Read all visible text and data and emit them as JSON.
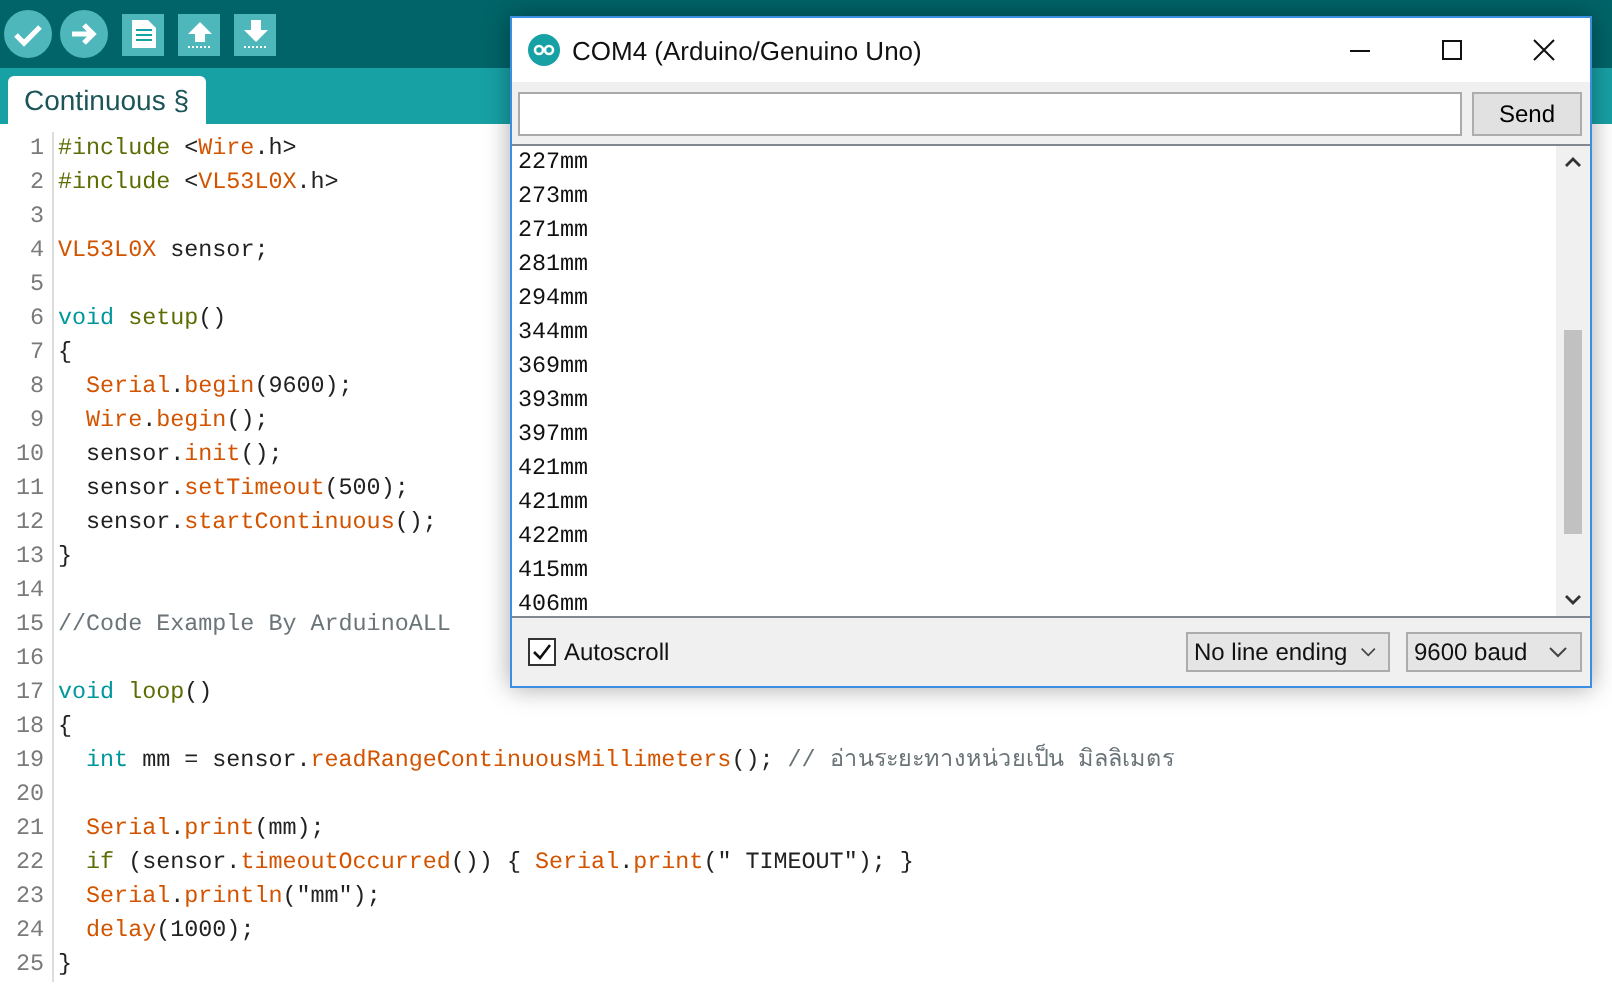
{
  "toolbar": {
    "buttons": [
      {
        "kind": "verify"
      },
      {
        "kind": "upload"
      },
      {
        "kind": "new"
      },
      {
        "kind": "open"
      },
      {
        "kind": "save"
      }
    ]
  },
  "tabs": [
    {
      "label": "Continuous §",
      "selected": true
    }
  ],
  "code": [
    {
      "number": "1",
      "tokens": [
        {
          "kind": "directive",
          "text": "#include"
        },
        {
          "kind": "plain",
          "text": " <"
        },
        {
          "kind": "lib",
          "text": "Wire"
        },
        {
          "kind": "plain",
          "text": ".h>"
        }
      ]
    },
    {
      "number": "2",
      "tokens": [
        {
          "kind": "directive",
          "text": "#include"
        },
        {
          "kind": "plain",
          "text": " <"
        },
        {
          "kind": "lib",
          "text": "VL53L0X"
        },
        {
          "kind": "plain",
          "text": ".h>"
        }
      ]
    },
    {
      "number": "3"
    },
    {
      "number": "4",
      "tokens": [
        {
          "kind": "lib",
          "text": "VL53L0X"
        },
        {
          "kind": "plain",
          "text": " sensor;"
        }
      ]
    },
    {
      "number": "5"
    },
    {
      "number": "6",
      "tokens": [
        {
          "kind": "type",
          "text": "void"
        },
        {
          "kind": "func",
          "text": " setup"
        },
        {
          "kind": "plain",
          "text": "()"
        }
      ]
    },
    {
      "number": "7",
      "tokens": [
        {
          "kind": "plain",
          "text": "{"
        }
      ]
    },
    {
      "number": "8",
      "tokens": [
        {
          "kind": "lib",
          "text": "  Serial"
        },
        {
          "kind": "plain",
          "text": "."
        },
        {
          "kind": "method",
          "text": "begin"
        },
        {
          "kind": "plain",
          "text": "(9600);"
        }
      ]
    },
    {
      "number": "9",
      "tokens": [
        {
          "kind": "lib",
          "text": "  Wire"
        },
        {
          "kind": "plain",
          "text": "."
        },
        {
          "kind": "method",
          "text": "begin"
        },
        {
          "kind": "plain",
          "text": "();"
        }
      ]
    },
    {
      "number": "10",
      "tokens": [
        {
          "kind": "plain",
          "text": "  sensor."
        },
        {
          "kind": "method",
          "text": "init"
        },
        {
          "kind": "plain",
          "text": "();"
        }
      ]
    },
    {
      "number": "11",
      "tokens": [
        {
          "kind": "plain",
          "text": "  sensor."
        },
        {
          "kind": "method",
          "text": "setTimeout"
        },
        {
          "kind": "plain",
          "text": "(500);"
        }
      ]
    },
    {
      "number": "12",
      "tokens": [
        {
          "kind": "plain",
          "text": "  sensor."
        },
        {
          "kind": "method",
          "text": "startContinuous"
        },
        {
          "kind": "plain",
          "text": "();"
        }
      ]
    },
    {
      "number": "13",
      "tokens": [
        {
          "kind": "plain",
          "text": "}"
        }
      ]
    },
    {
      "number": "14"
    },
    {
      "number": "15",
      "tokens": [
        {
          "kind": "comment",
          "text": "//Code Example By ArduinoALL"
        }
      ]
    },
    {
      "number": "16"
    },
    {
      "number": "17",
      "tokens": [
        {
          "kind": "type",
          "text": "void"
        },
        {
          "kind": "func",
          "text": " loop"
        },
        {
          "kind": "plain",
          "text": "()"
        }
      ]
    },
    {
      "number": "18",
      "tokens": [
        {
          "kind": "plain",
          "text": "{"
        }
      ]
    },
    {
      "number": "19",
      "tokens": [
        {
          "kind": "type",
          "text": "  int"
        },
        {
          "kind": "plain",
          "text": " mm = sensor."
        },
        {
          "kind": "method",
          "text": "readRangeContinuousMillimeters"
        },
        {
          "kind": "plain",
          "text": "(); "
        },
        {
          "kind": "comment",
          "text": "// อ่านระยะทางหน่วยเป็น มิลลิเมตร"
        }
      ]
    },
    {
      "number": "20"
    },
    {
      "number": "21",
      "tokens": [
        {
          "kind": "lib",
          "text": "  Serial"
        },
        {
          "kind": "plain",
          "text": "."
        },
        {
          "kind": "method",
          "text": "print"
        },
        {
          "kind": "plain",
          "text": "(mm);"
        }
      ]
    },
    {
      "number": "22",
      "tokens": [
        {
          "kind": "directive",
          "text": "  if"
        },
        {
          "kind": "plain",
          "text": " (sensor."
        },
        {
          "kind": "method",
          "text": "timeoutOccurred"
        },
        {
          "kind": "plain",
          "text": "()) { "
        },
        {
          "kind": "lib",
          "text": "Serial"
        },
        {
          "kind": "plain",
          "text": "."
        },
        {
          "kind": "method",
          "text": "print"
        },
        {
          "kind": "plain",
          "text": "(\" TIMEOUT\"); }"
        }
      ]
    },
    {
      "number": "23",
      "tokens": [
        {
          "kind": "lib",
          "text": "  Serial"
        },
        {
          "kind": "plain",
          "text": "."
        },
        {
          "kind": "method",
          "text": "println"
        },
        {
          "kind": "plain",
          "text": "(\"mm\");"
        }
      ]
    },
    {
      "number": "24",
      "tokens": [
        {
          "kind": "method",
          "text": "  delay"
        },
        {
          "kind": "plain",
          "text": "(1000);"
        }
      ]
    },
    {
      "number": "25",
      "tokens": [
        {
          "kind": "plain",
          "text": "}"
        }
      ]
    }
  ],
  "serial_monitor": {
    "title": "COM4 (Arduino/Genuino Uno)",
    "send_button": "Send",
    "output": [
      "227mm",
      "273mm",
      "271mm",
      "281mm",
      "294mm",
      "344mm",
      "369mm",
      "393mm",
      "397mm",
      "421mm",
      "421mm",
      "422mm",
      "415mm",
      "406mm"
    ],
    "autoscroll": {
      "label": "Autoscroll",
      "checked": true
    },
    "line_ending": "No line ending",
    "baud": "9600 baud"
  }
}
